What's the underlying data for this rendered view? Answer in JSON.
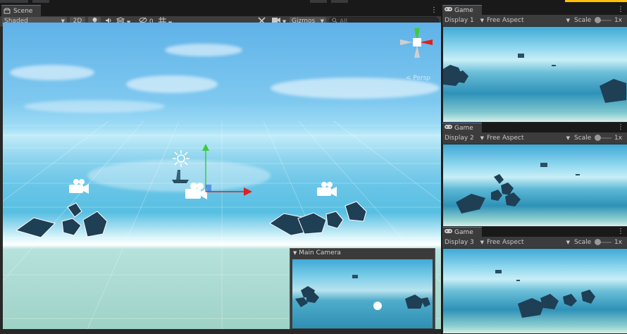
{
  "scene": {
    "tab_label": "Scene",
    "shading_mode": "Shaded",
    "mode_2d": "2D",
    "hidden_count": "0",
    "gizmos_label": "Gizmos",
    "search_placeholder": "All",
    "persp_label": "< Persp",
    "camera_preview_title": "Main Camera"
  },
  "games": [
    {
      "tab_label": "Game",
      "display": "Display 1",
      "aspect": "Free Aspect",
      "scale_label": "Scale",
      "scale_value": "1x"
    },
    {
      "tab_label": "Game",
      "display": "Display 2",
      "aspect": "Free Aspect",
      "scale_label": "Scale",
      "scale_value": "1x"
    },
    {
      "tab_label": "Game",
      "display": "Display 3",
      "aspect": "Free Aspect",
      "scale_label": "Scale",
      "scale_value": "1x"
    }
  ],
  "colors": {
    "accent": "#3d77c4",
    "panel": "#3c3c3c",
    "rock": "#1f3f55",
    "axis_x": "#e02020",
    "axis_y": "#3ccb3c",
    "axis_z": "#2f6be0"
  },
  "icons": [
    "scene-icon",
    "game-icon",
    "light-icon",
    "audio-icon",
    "effects-icon",
    "visibility-icon",
    "grid-icon",
    "tools-icon",
    "camera-icon",
    "search-icon",
    "kebab-icon"
  ]
}
